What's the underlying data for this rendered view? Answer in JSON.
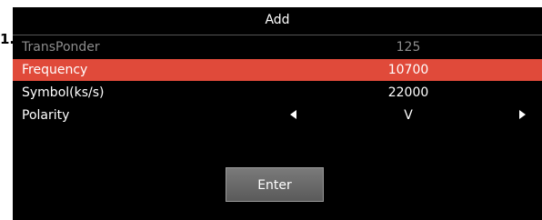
{
  "dialog": {
    "title": "Add",
    "fields": [
      {
        "label": "TransPonder",
        "value": "125"
      },
      {
        "label": "Frequency",
        "value": "10700"
      },
      {
        "label": "Symbol(ks/s)",
        "value": "22000"
      },
      {
        "label": "Polarity",
        "value": "V"
      }
    ],
    "selected_index": 1,
    "enter_label": "Enter"
  },
  "colors": {
    "background": "#000000",
    "selected_row": "#e04a3a",
    "disabled_text": "#8d8d8d",
    "button": "#6a6a6a"
  },
  "icons": [
    "left-arrow-icon",
    "right-arrow-icon"
  ],
  "edge_fragment": "1."
}
